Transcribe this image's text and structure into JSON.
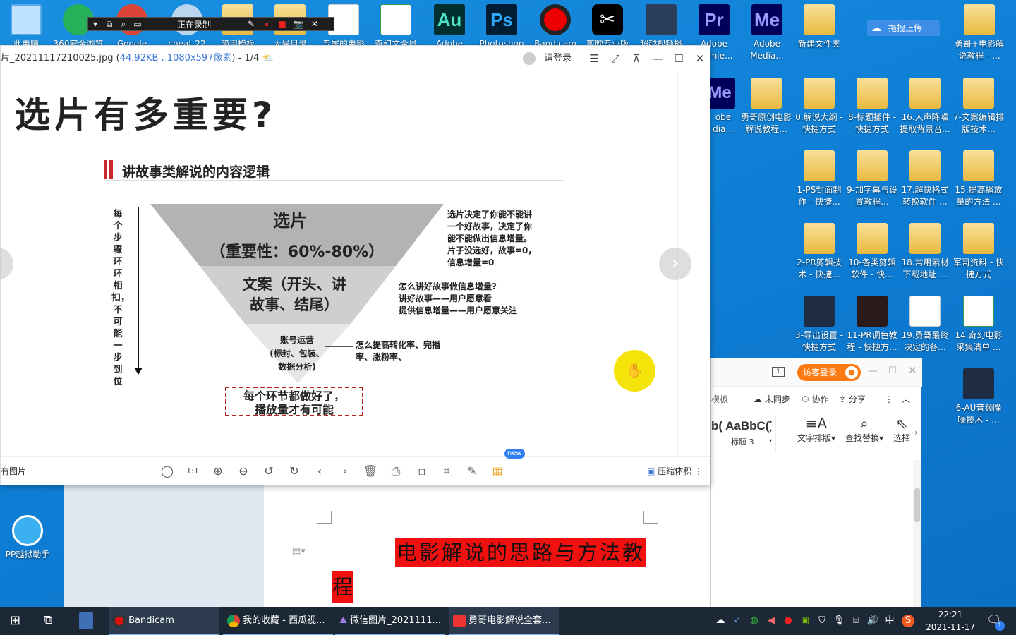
{
  "desktop_top_row": [
    "此电脑",
    "360安全浏览",
    "Google",
    "cheat-22",
    "简用模板",
    "大号目录",
    "专属的电影",
    "奇幻文全员",
    "Adobe",
    "Photoshop",
    "Bandicam",
    "剪映专业版",
    "超越视频播",
    "Adobe Premie...",
    "Adobe Media...",
    "新建文件夹"
  ],
  "app_tiles": {
    "au": "Au",
    "ps": "Ps",
    "pr": "Pr",
    "me": "Me"
  },
  "desktop_icons": [
    {
      "label": "新建文件夹"
    },
    {
      "label": "勇哥+电影解说教程 - ..."
    },
    {
      "label": "勇哥原创电影解说教程..."
    },
    {
      "label": "0.解说大纲 - 快捷方式"
    },
    {
      "label": "8-标题插件 - 快捷方式"
    },
    {
      "label": "16.人声降噪提取背景音..."
    },
    {
      "label": "7-文案编辑排版技术..."
    },
    {
      "label": "1-PS封面制作 - 快捷..."
    },
    {
      "label": "9-加字幕与设置教程..."
    },
    {
      "label": "17.超快格式转换软件 ..."
    },
    {
      "label": "15.提高播放量的方法 ..."
    },
    {
      "label": "2-PR剪辑技术 - 快捷..."
    },
    {
      "label": "10-各类剪辑软件 - 快..."
    },
    {
      "label": "18.常用素材下载地址 ..."
    },
    {
      "label": "军哥资料 - 快捷方式"
    },
    {
      "label": "3-导出设置 - 快捷方式"
    },
    {
      "label": "11-PR调色教程 - 快捷方..."
    },
    {
      "label": "19.勇哥最终决定的各..."
    },
    {
      "label": "14.奇幻电影采集清单 ..."
    },
    {
      "label": "6-AU音频降噪技术 - ..."
    },
    {
      "label": "PP越狱助手"
    }
  ],
  "partial_labels": {
    "adobe": "obe",
    "media": "dia..."
  },
  "upload_button": "拖拽上传",
  "recorder": {
    "status": "正在录制"
  },
  "viewer": {
    "title_prefix": "片_20211117210025.jpg (",
    "size": "44.92KB , 1080x597像素",
    "title_suffix": ") - 1/4",
    "login": "请登录",
    "bottom_left": "有图片",
    "compress": "压缩体积",
    "new_badge": "new"
  },
  "slide": {
    "title": "选片有多重要?",
    "section": "讲故事类解说的内容逻辑",
    "vertical_text": "每个步骤环环相扣，不可能一步到位",
    "layer1_line1": "选片",
    "layer1_line2": "（重要性：60%-80%）",
    "layer2_line1": "文案（开头、讲",
    "layer2_line2": "故事、结尾）",
    "layer3_line1": "账号运营",
    "layer3_line2": "(标封、包装、",
    "layer3_line3": "数据分析)",
    "note1": [
      "选片决定了你能不能讲",
      "一个好故事，决定了你",
      "能不能做出信息增量。",
      "片子没选好，故事=0，",
      "信息增量=0"
    ],
    "note2": [
      "怎么讲好故事做信息增量?",
      "讲好故事——用户愿意看",
      "提供信息增量——用户愿意关注"
    ],
    "note3": [
      "怎么提高转化率、完播",
      "率、涨粉率、"
    ],
    "bottom_box": [
      "每个环节都做好了，",
      "播放量才有可能"
    ]
  },
  "wps": {
    "guest_login": "访客登录",
    "template": "模板",
    "unsync": "未同步",
    "collab": "协作",
    "share": "分享",
    "style_preview": "b( AaBbC(",
    "heading": "标题 3",
    "text_layout": "文字排版",
    "find_replace": "查找替换",
    "select": "选择"
  },
  "document": {
    "heading_line1": "电影解说的思路与方法教",
    "heading_line2": "程"
  },
  "taskbar": {
    "tasks": [
      "Bandicam",
      "我的收藏 - 西瓜视...",
      "微信图片_2021111...",
      "勇哥电影解说全套..."
    ],
    "time": "22:21",
    "date": "2021-11-17",
    "ime": "中",
    "notification_count": "1"
  }
}
